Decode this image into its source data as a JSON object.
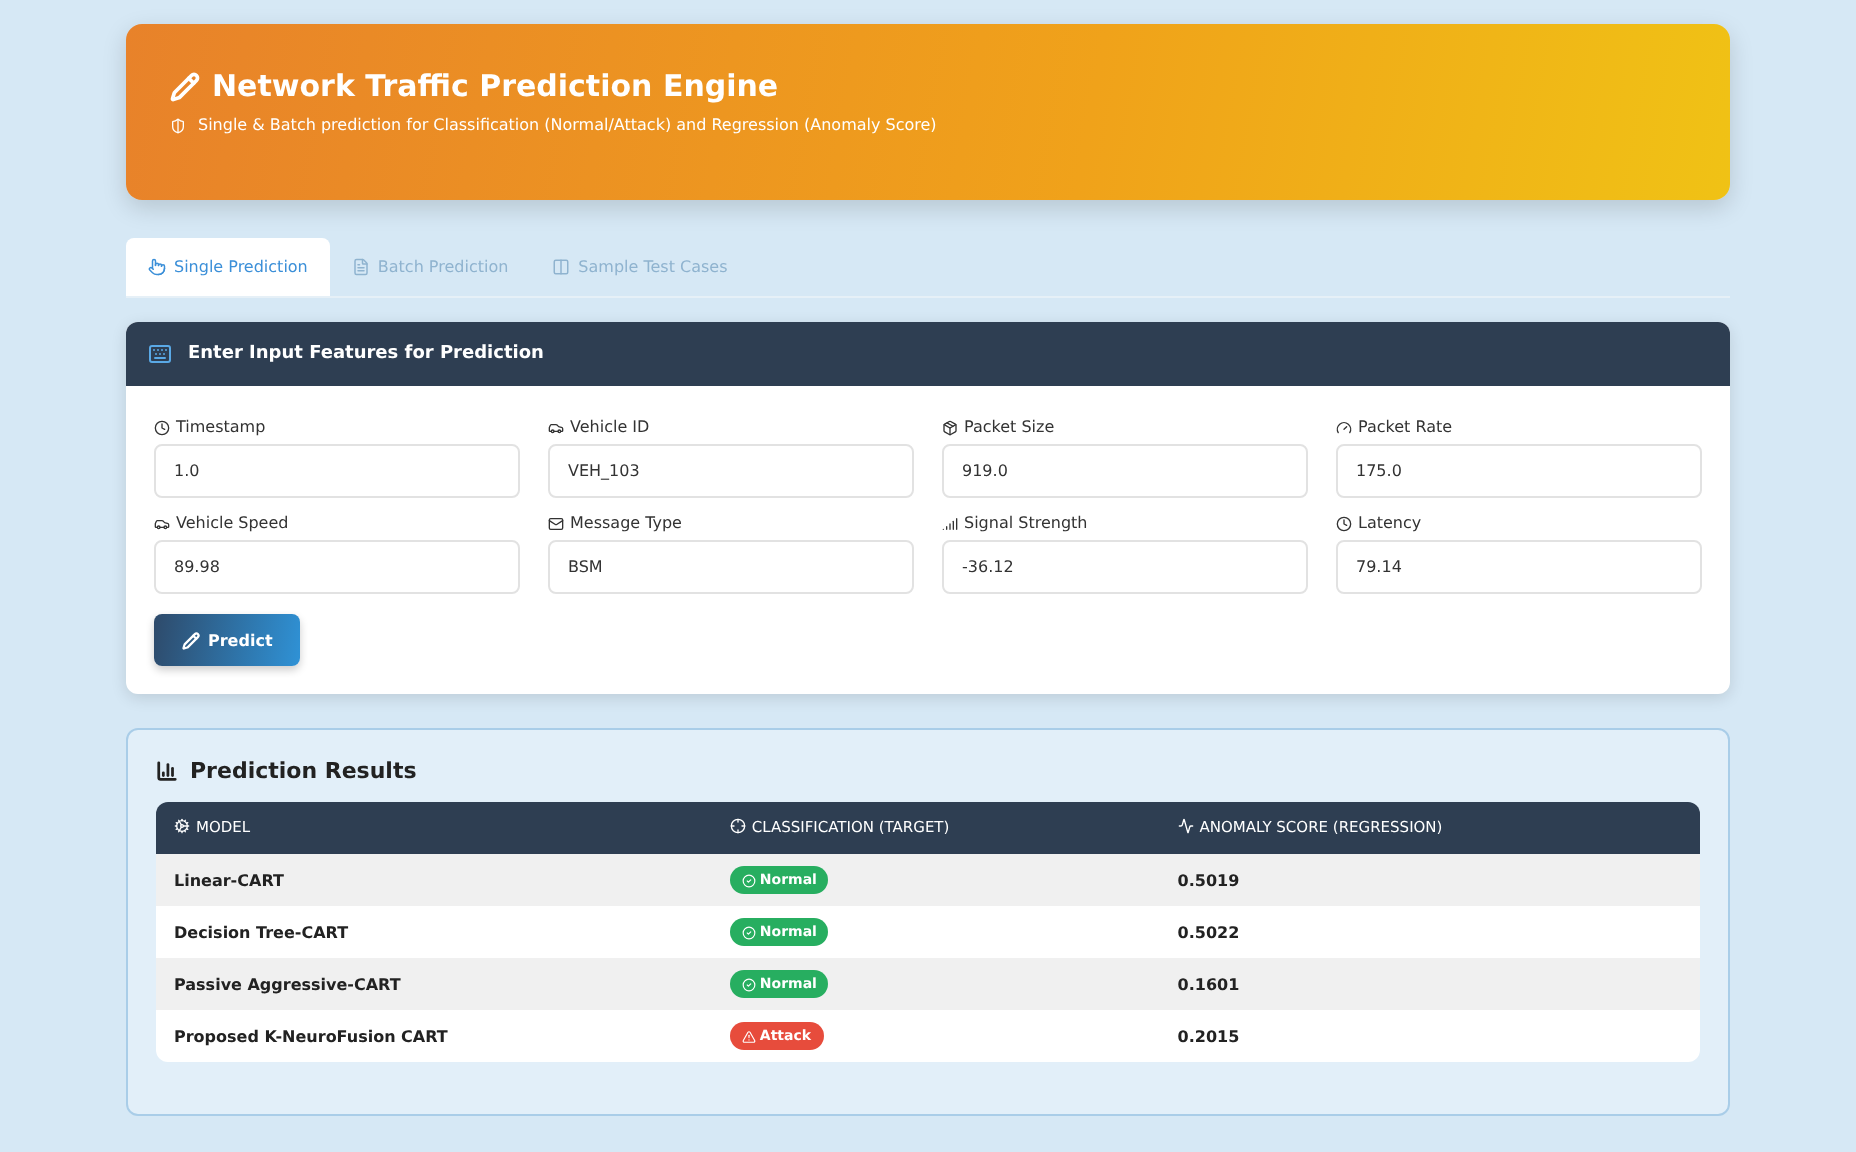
{
  "header": {
    "title": "Network Traffic Prediction Engine",
    "subtitle": "Single & Batch prediction for Classification (Normal/Attack) and Regression (Anomaly Score)"
  },
  "tabs": [
    {
      "label": "Single Prediction",
      "kind": "single",
      "selected": true
    },
    {
      "label": "Batch Prediction",
      "kind": "batch",
      "selected": false
    },
    {
      "label": "Sample Test Cases",
      "kind": "samples",
      "selected": false
    }
  ],
  "input_card": {
    "title": "Enter Input Features for Prediction",
    "fields": [
      {
        "label": "Timestamp",
        "kind": "clock",
        "value": "1.0"
      },
      {
        "label": "Vehicle ID",
        "kind": "car",
        "value": "VEH_103"
      },
      {
        "label": "Packet Size",
        "kind": "box",
        "value": "919.0"
      },
      {
        "label": "Packet Rate",
        "kind": "gauge",
        "value": "175.0"
      },
      {
        "label": "Vehicle Speed",
        "kind": "car",
        "value": "89.98"
      },
      {
        "label": "Message Type",
        "kind": "mail",
        "value": "BSM"
      },
      {
        "label": "Signal Strength",
        "kind": "signal",
        "value": "-36.12"
      },
      {
        "label": "Latency",
        "kind": "clock",
        "value": "79.14"
      }
    ],
    "button": "Predict"
  },
  "results": {
    "title": "Prediction Results",
    "columns": [
      {
        "label": "MODEL",
        "kind": "gear"
      },
      {
        "label": "CLASSIFICATION (TARGET)",
        "kind": "target"
      },
      {
        "label": "ANOMALY SCORE (REGRESSION)",
        "kind": "pulse"
      }
    ],
    "rows": [
      {
        "model": "Linear-CART",
        "classification": "Normal",
        "kind": "normal",
        "score": "0.5019"
      },
      {
        "model": "Decision Tree-CART",
        "classification": "Normal",
        "kind": "normal",
        "score": "0.5022"
      },
      {
        "model": "Passive Aggressive-CART",
        "classification": "Normal",
        "kind": "normal",
        "score": "0.1601"
      },
      {
        "model": "Proposed K-NeuroFusion CART",
        "classification": "Attack",
        "kind": "attack",
        "score": "0.2015"
      }
    ]
  }
}
